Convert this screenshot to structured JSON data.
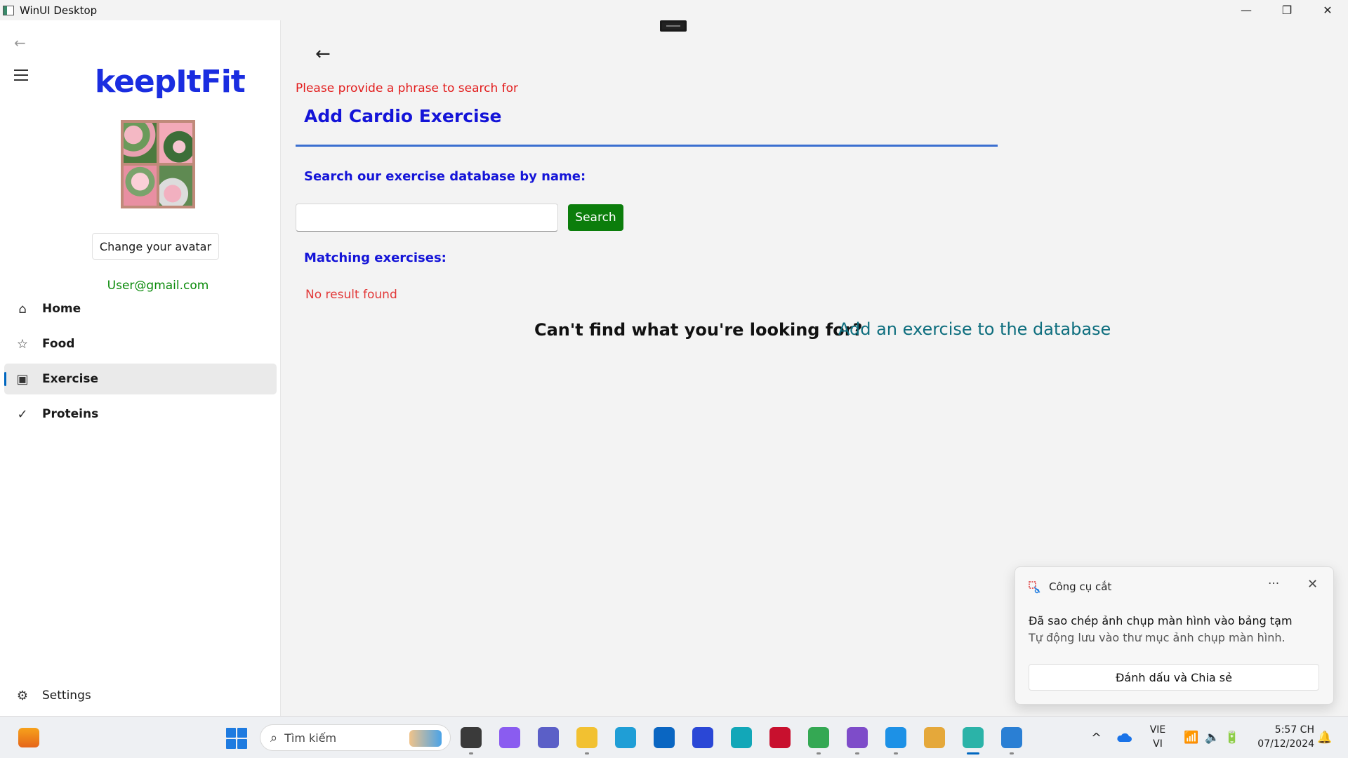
{
  "window": {
    "title": "WinUI Desktop",
    "controls": {
      "minimize": "—",
      "restore": "❐",
      "close": "✕"
    }
  },
  "sidebar": {
    "back_icon": "←",
    "brand": "keepItFit",
    "avatar_button": "Change your avatar",
    "email": "User@gmail.com",
    "items": [
      {
        "label": "Home",
        "icon": "home-icon",
        "glyph": "⌂"
      },
      {
        "label": "Food",
        "icon": "star-icon",
        "glyph": "☆"
      },
      {
        "label": "Exercise",
        "icon": "exercise-icon",
        "glyph": "▣",
        "selected": true
      },
      {
        "label": "Proteins",
        "icon": "checkmark-icon",
        "glyph": "✓"
      }
    ],
    "settings": {
      "label": "Settings",
      "icon": "gear-icon",
      "glyph": "⚙"
    }
  },
  "main": {
    "back_icon": "←",
    "error": "Please provide a phrase to search for",
    "title": "Add Cardio Exercise",
    "search_label": "Search our exercise database by name:",
    "search_value": "",
    "search_button": "Search",
    "matching_label": "Matching exercises:",
    "no_result": "No result found",
    "cant_find": "Can't find what you're looking for?",
    "add_link": "Add an exercise to the database"
  },
  "toast": {
    "app": "Công cụ cắt",
    "more": "···",
    "close": "✕",
    "title": "Đã sao chép ảnh chụp màn hình vào bảng tạm",
    "body": "Tự động lưu vào thư mục ảnh chụp màn hình.",
    "button": "Đánh dấu và Chia sẻ"
  },
  "taskbar": {
    "search_placeholder": "Tìm kiếm",
    "language": [
      "VIE",
      "VI"
    ],
    "time": "5:57 CH",
    "date": "07/12/2024",
    "tray_chevron": "^",
    "apps": [
      {
        "name": "file-explorer-taskview-icon",
        "color": "#3a3a3a"
      },
      {
        "name": "copilot-icon",
        "color": "#8a5cf0"
      },
      {
        "name": "teams-icon",
        "color": "#5b5fc7"
      },
      {
        "name": "folder-icon",
        "color": "#f2c131"
      },
      {
        "name": "edge-icon",
        "color": "#1f9ed6"
      },
      {
        "name": "store-icon",
        "color": "#0a66c2"
      },
      {
        "name": "vector-app-icon",
        "color": "#2a47d6"
      },
      {
        "name": "cortana-icon",
        "color": "#12a7b8"
      },
      {
        "name": "mcafee-icon",
        "color": "#c8102e"
      },
      {
        "name": "chrome-icon",
        "color": "#34a853"
      },
      {
        "name": "visual-studio-icon",
        "color": "#7e4cc9"
      },
      {
        "name": "docker-icon",
        "color": "#1d91e6"
      },
      {
        "name": "paint-icon",
        "color": "#e5a83a"
      },
      {
        "name": "winui-app-icon",
        "color": "#2bb3a8"
      },
      {
        "name": "notepad-icon",
        "color": "#2a7fd4"
      }
    ]
  }
}
